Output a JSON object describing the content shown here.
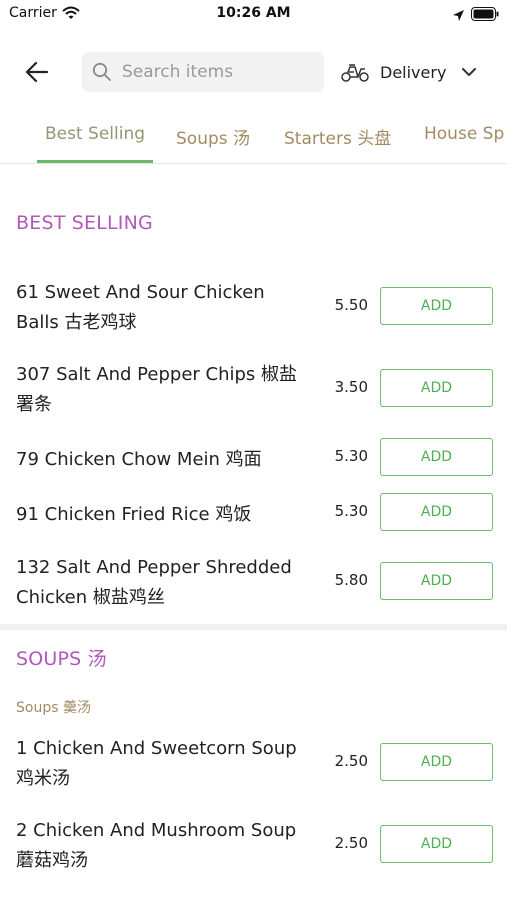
{
  "status_bar": {
    "carrier": "Carrier",
    "time": "10:26 AM"
  },
  "header": {
    "search_placeholder": "Search items",
    "delivery_label": "Delivery"
  },
  "tabs": [
    {
      "label": "Best Selling",
      "active": true
    },
    {
      "label": "Soups 汤",
      "active": false
    },
    {
      "label": "Starters 头盘",
      "active": false
    },
    {
      "label": "House Sp",
      "active": false
    }
  ],
  "sections": [
    {
      "title": "BEST SELLING",
      "items": [
        {
          "name": "61 Sweet And Sour Chicken Balls 古老鸡球",
          "price": "5.50",
          "button": "ADD"
        },
        {
          "name": "307 Salt And Pepper Chips 椒盐署条",
          "price": "3.50",
          "button": "ADD"
        },
        {
          "name": "79 Chicken Chow Mein 鸡面",
          "price": "5.30",
          "button": "ADD"
        },
        {
          "name": "91 Chicken Fried Rice 鸡饭",
          "price": "5.30",
          "button": "ADD"
        },
        {
          "name": "132 Salt And Pepper Shredded Chicken 椒盐鸡丝",
          "price": "5.80",
          "button": "ADD"
        }
      ]
    },
    {
      "title": "SOUPS 汤",
      "subtitle": "Soups 羹汤",
      "items": [
        {
          "name": "1 Chicken And Sweetcorn Soup 鸡米汤",
          "price": "2.50",
          "button": "ADD"
        },
        {
          "name": "2 Chicken And Mushroom Soup 蘑菇鸡汤",
          "price": "2.50",
          "button": "ADD"
        }
      ]
    }
  ],
  "colors": {
    "section_title": "#b05ab8",
    "tab_text": "#a38b63",
    "accent_green": "#6cb86a"
  }
}
